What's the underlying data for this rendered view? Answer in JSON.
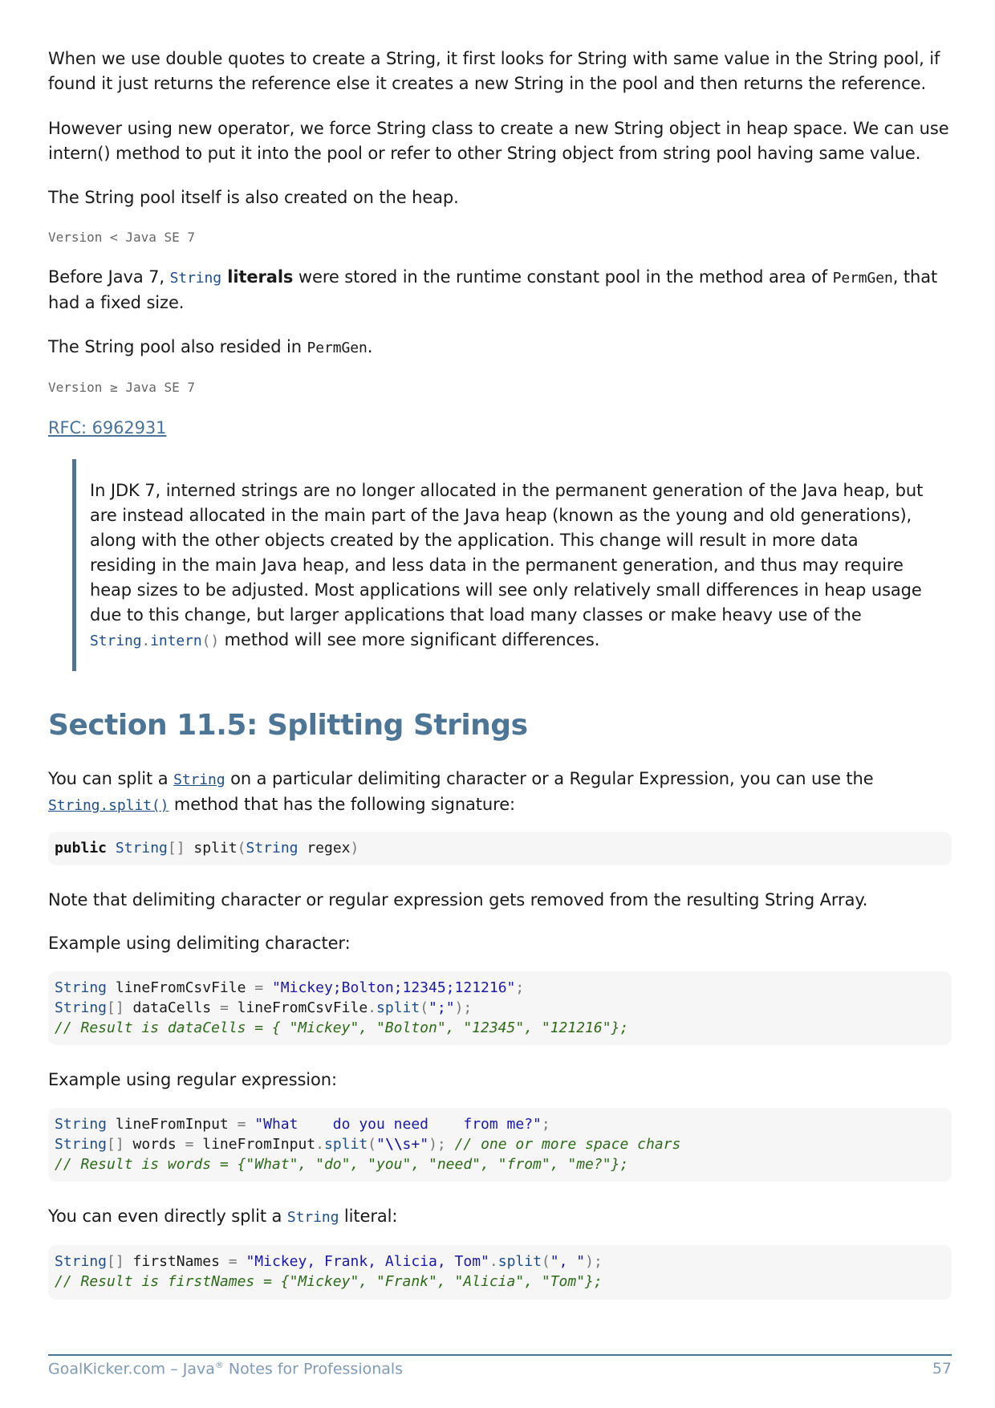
{
  "paragraphs": {
    "p1": "When we use double quotes to create a String, it first looks for String with same value in the String pool, if found it just returns the reference else it creates a new String in the pool and then returns the reference.",
    "p2": "However using new operator, we force String class to create a new String object in heap space. We can use intern() method to put it into the pool or refer to other String object from string pool having same value.",
    "p3": "The String pool itself is also created on the heap.",
    "p4_a": "Before Java 7, ",
    "p4_code": "String",
    "p4_bold": " literals",
    "p4_b": " were stored in the runtime constant pool in the method area of ",
    "p4_code2": "PermGen",
    "p4_c": ", that had a fixed size.",
    "p5_a": "The String pool also resided in ",
    "p5_code": "PermGen",
    "p5_b": "."
  },
  "versions": {
    "v1": "Version < Java SE 7",
    "v2": "Version ≥ Java SE 7"
  },
  "rfc_link": "RFC: 6962931",
  "quote": {
    "text_a": "In JDK 7, interned strings are no longer allocated in the permanent generation of the Java heap, but are instead allocated in the main part of the Java heap (known as the young and old generations), along with the other objects created by the application. This change will result in more data residing in the main Java heap, and less data in the permanent generation, and thus may require heap sizes to be adjusted. Most applications will see only relatively small differences in heap usage due to this change, but larger applications that load many classes or make heavy use of the ",
    "code_type": "String",
    "code_dot": ".",
    "code_method": "intern",
    "code_parens": "()",
    "text_b": " method will see more significant differences."
  },
  "section": {
    "title": "Section 11.5: Splitting Strings",
    "intro_a": "You can split a ",
    "intro_link1": "String",
    "intro_b": " on a particular delimiting character or a Regular Expression, you can use the ",
    "intro_link2": "String.split()",
    "intro_c": " method that has the following signature:",
    "signature": {
      "kw": "public",
      "type": "String",
      "brackets": "[]",
      "name": " split",
      "open": "(",
      "ptype": "String",
      "pname": " regex",
      "close": ")"
    },
    "note": "Note that delimiting character or regular expression gets removed from the resulting String Array.",
    "example1_label": "Example using delimiting character:",
    "example1": {
      "l1_type": "String",
      "l1_rest": " lineFromCsvFile ",
      "l1_eq": "=",
      "l1_str": " \"Mickey;Bolton;12345;121216\"",
      "l1_semi": ";",
      "l2_type": "String",
      "l2_br": "[]",
      "l2_rest": " dataCells ",
      "l2_eq": "=",
      "l2_obj": " lineFromCsvFile",
      "l2_dot": ".",
      "l2_method": "split",
      "l2_open": "(",
      "l2_str": "\";\"",
      "l2_close": ");",
      "l3_comment": "// Result is dataCells = { \"Mickey\", \"Bolton\", \"12345\", \"121216\"};"
    },
    "example2_label": "Example using regular expression:",
    "example2": {
      "l1_type": "String",
      "l1_rest": " lineFromInput ",
      "l1_eq": "=",
      "l1_str": " \"What    do you need    from me?\"",
      "l1_semi": ";",
      "l2_type": "String",
      "l2_br": "[]",
      "l2_rest": " words ",
      "l2_eq": "=",
      "l2_obj": " lineFromInput",
      "l2_dot": ".",
      "l2_method": "split",
      "l2_open": "(",
      "l2_q1": "\"",
      "l2_esc": "\\\\",
      "l2_str": "s+\"",
      "l2_close": "); ",
      "l2_comment": "// one or more space chars",
      "l3_comment": "// Result is words = {\"What\", \"do\", \"you\", \"need\", \"from\", \"me?\"};"
    },
    "literal_a": "You can even directly split a ",
    "literal_code": "String",
    "literal_b": " literal:",
    "example3": {
      "l1_type": "String",
      "l1_br": "[]",
      "l1_rest": " firstNames ",
      "l1_eq": "=",
      "l1_str": " \"Mickey, Frank, Alicia, Tom\"",
      "l1_dot": ".",
      "l1_method": "split",
      "l1_open": "(",
      "l1_arg": "\", \"",
      "l1_close": ");",
      "l2_comment": "// Result is firstNames = {\"Mickey\", \"Frank\", \"Alicia\", \"Tom\"};"
    }
  },
  "footer": {
    "left_a": "GoalKicker.com – Java",
    "left_reg": "®",
    "left_b": " Notes for Professionals",
    "page": "57"
  }
}
